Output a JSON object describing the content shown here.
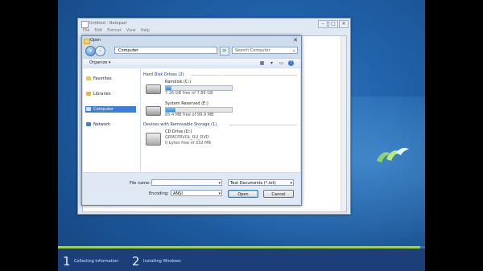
{
  "notepad": {
    "title": "Untitled - Notepad",
    "menu": [
      "File",
      "Edit",
      "Format",
      "View",
      "Help"
    ],
    "controls": [
      "–",
      "□",
      "✕"
    ]
  },
  "dialog": {
    "title": "Open",
    "close": "✕",
    "address": "Computer",
    "search_placeholder": "Search Computer",
    "organize": "Organize ▾",
    "nav": [
      {
        "label": "Favorites",
        "color": "#f2c64a"
      },
      {
        "label": "Libraries",
        "color": "#e0b44c"
      },
      {
        "label": "Computer",
        "color": "#5a8fd0",
        "selected": true
      },
      {
        "label": "Network",
        "color": "#4a7fc0"
      }
    ],
    "groups": {
      "hdd": "Hard Disk Drives (2)",
      "removable": "Devices with Removable Storage (1)"
    },
    "drives": [
      {
        "name": "Ramdisk (C:)",
        "used_fraction": 0.08,
        "free": "7.26 GB free of 7.89 GB"
      },
      {
        "name": "System Reserved (E:)",
        "used_fraction": 0.15,
        "free": "85.4 MB free of 99.9 MB"
      }
    ],
    "cd": {
      "name": "CD Drive (D:)",
      "label": "GRMCPRVOL_RU_DVD",
      "free": "0 bytes free of 332 MB"
    },
    "file_name_label": "File name:",
    "file_name_value": "",
    "file_type": "Text Documents (*.txt)",
    "encoding_label": "Encoding:",
    "encoding_value": "ANSI",
    "open_button": "Open",
    "cancel_button": "Cancel"
  },
  "setup": {
    "step1_num": "1",
    "step1_text": "Collecting information",
    "step2_num": "2",
    "step2_text": "Installing Windows",
    "progress": 0.98,
    "accent": "#9fd05a"
  }
}
